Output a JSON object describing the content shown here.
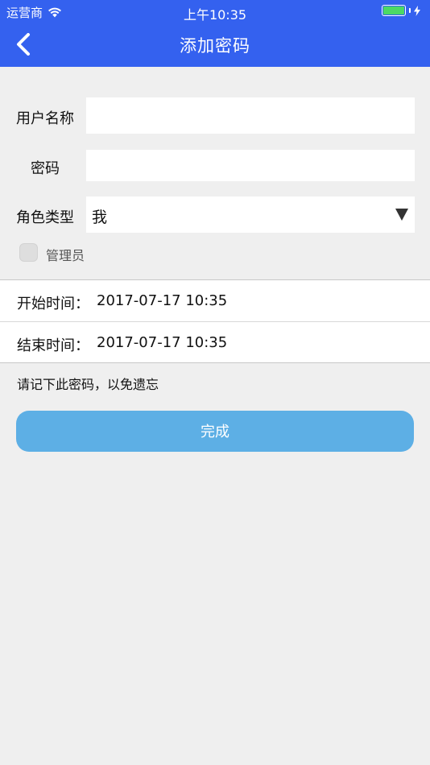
{
  "status_bar": {
    "carrier": "运营商",
    "time": "上午10:35",
    "battery_color": "#4cd964",
    "icons": [
      "wifi-icon",
      "battery-icon",
      "charging-bolt-icon"
    ]
  },
  "nav": {
    "title": "添加密码",
    "back_icon": "chevron-left-icon",
    "background": "#3461ef"
  },
  "form": {
    "username_label": "用户名称",
    "username_value": "",
    "password_label": "密码",
    "password_value": "",
    "role_label": "角色类型",
    "role_selected": "我",
    "role_dropdown_icon": "triangle-down-icon",
    "admin_checkbox_label": "管理员",
    "admin_checked": false
  },
  "times": {
    "start_label": "开始时间：",
    "start_value": "2017-07-17 10:35",
    "end_label": "结束时间：",
    "end_value": "2017-07-17 10:35"
  },
  "hint": "请记下此密码，以免遗忘",
  "done_button": {
    "label": "完成",
    "color": "#5dafe5"
  }
}
